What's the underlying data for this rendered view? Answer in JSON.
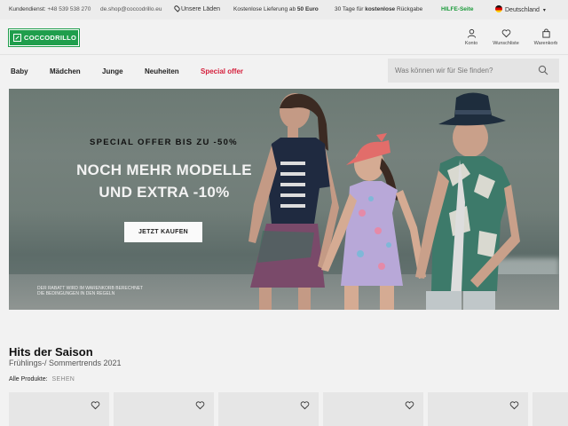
{
  "topbar": {
    "customer_service_label": "Kundendienst:",
    "phone": "+48 539 538 270",
    "email": "de.shop@coccodrillo.eu",
    "stores": "Unsere Läden",
    "shipping_prefix": "Kostenlose Lieferung ab",
    "shipping_amount": "50 Euro",
    "returns_prefix": "30 Tage für",
    "returns_bold": "kostenlose",
    "returns_suffix": "Rückgabe",
    "help": "HILFE-Seite",
    "country": "Deutschland"
  },
  "header": {
    "logo": "COCCODRILLO",
    "icons": [
      {
        "label": "Konto",
        "icon": "user-icon"
      },
      {
        "label": "Wunschliste",
        "icon": "heart-icon"
      },
      {
        "label": "Warenkorb",
        "icon": "bag-icon"
      }
    ]
  },
  "nav": {
    "items": [
      "Baby",
      "Mädchen",
      "Junge",
      "Neuheiten",
      "Special offer"
    ],
    "search_placeholder": "Was können wir für Sie finden?"
  },
  "hero": {
    "kicker": "SPECIAL OFFER BIS ZU -50%",
    "headline_1": "NOCH MEHR MODELLE",
    "headline_2": "UND EXTRA -10%",
    "cta": "JETZT KAUFEN",
    "disclaimer_1": "DER RABATT WIRD IM WARENKORB BERECHNET",
    "disclaimer_2": "DIE BEDINGUNGEN IN DEN REGELN"
  },
  "hits": {
    "title": "Hits der Saison",
    "subtitle": "Frühlings-/ Sommertrends 2021",
    "all_products": "Alle Produkte:",
    "see": "SEHEN"
  },
  "colors": {
    "brand_green": "#1f9e4c",
    "special_red": "#d5203c",
    "help_green": "#1a9a3a"
  }
}
